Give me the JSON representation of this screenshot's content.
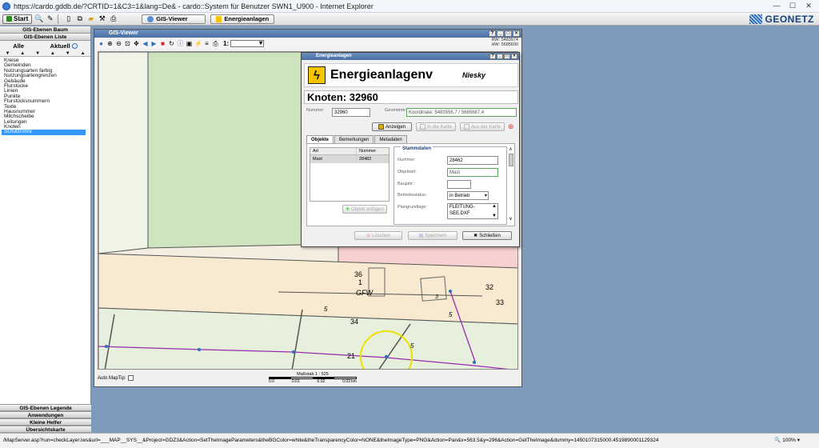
{
  "browser": {
    "title": "https://cardo.gddb.de/?CRTID=1&C3=1&lang=De& - cardo::System für Benutzer SWN1_U900 - Internet Explorer",
    "status_url": "/MapServer.asp?run=checkLayer.iws&url=___MAP__SYS__&Project=GDZ3&Action=SetTheImageParameters&theBGColor=white&theTransparencyColor=NONE&theImageType=PNG&Action=Pan&x=563.5&y=296&Action=GetTheImage&dummy=1450107315000.4519890001129324",
    "zoom": "100%"
  },
  "toolbar": {
    "start_label": "Start",
    "tasks": [
      {
        "label": "GIS-Viewer"
      },
      {
        "label": "Energieanlagen"
      }
    ],
    "brand": "GEONETZ"
  },
  "left_panel": {
    "header_top": "GIS-Ebenen Baum",
    "header_list": "GIS-Ebenen Liste",
    "tab_all": "Alle",
    "tab_current": "Aktuell",
    "layers": [
      "Kreise",
      "Gemeinden",
      "Nutzungsarten farbig",
      "Nutzungsartengrenzen",
      "Gebäude",
      "Flurstücke",
      "Linien",
      "Punkte",
      "Flurstücksnummern",
      "Texte",
      "Hausnummer",
      "Milchscheibe",
      "Leitungen",
      "Knoten",
      "Schutzrohre"
    ],
    "selected_layer": "Schutzrohre",
    "bottom_headers": [
      "GIS-Ebenen Legende",
      "Anwendungen",
      "Kleine Helfer",
      "Übersichtskarte"
    ]
  },
  "gis_viewer": {
    "title": "GIS-Viewer",
    "scale_prefix": "1:",
    "rw": "RW: 5483574",
    "hw": "HW: 5685690",
    "map_labels": [
      "36",
      "1",
      "GFW",
      "32",
      "33",
      "34",
      "21",
      "5",
      "5",
      "3",
      "5"
    ],
    "auto_maptip": "Auto MapTip:",
    "scale_text": "Maßstab 1 : 525",
    "scale_ticks": [
      "0.0",
      "0.01",
      "0.02",
      "0.03 km"
    ]
  },
  "dialog": {
    "window_title": "Energieanlagen",
    "banner_title": "Energieanlagenv",
    "place": "Niesky",
    "heading": "Knoten: 32960",
    "nummer_label": "Nummer:",
    "nummer_value": "32960",
    "geometrie_label": "Geometrie:",
    "geometrie_value": "Koordinate: 5483556,7 / 5685687,4",
    "btn_anzeigen": "Anzeigen",
    "btn_in_karte": "In die Karte",
    "btn_aus_karte": "Aus der Karte",
    "tabs": [
      "Objekte",
      "Bemerkungen",
      "Metadaten"
    ],
    "table_headers": [
      "Art",
      "Nummer"
    ],
    "table_rows": [
      {
        "art": "Mast",
        "nummer": "28482"
      }
    ],
    "btn_objekt_anfuegen": "Objekt anfügen",
    "stammdaten_title": "Stammdaten",
    "st_nummer_label": "Nummer:",
    "st_nummer_value": "28462",
    "st_objektart_label": "Objektart:",
    "st_objektart_value": "Mast",
    "st_baujahr_label": "Baujahr:",
    "st_baujahr_value": "",
    "st_betrieb_label": "Betriebsstatus:",
    "st_betrieb_value": "in Betrieb",
    "st_plan_label": "Plangrundlage:",
    "st_plan_value_1": "FLEITUNG-",
    "st_plan_value_2": "SEE.DXF",
    "btn_loeschen": "Löschen",
    "btn_speichern": "Speichern",
    "btn_schliessen": "Schließen"
  }
}
